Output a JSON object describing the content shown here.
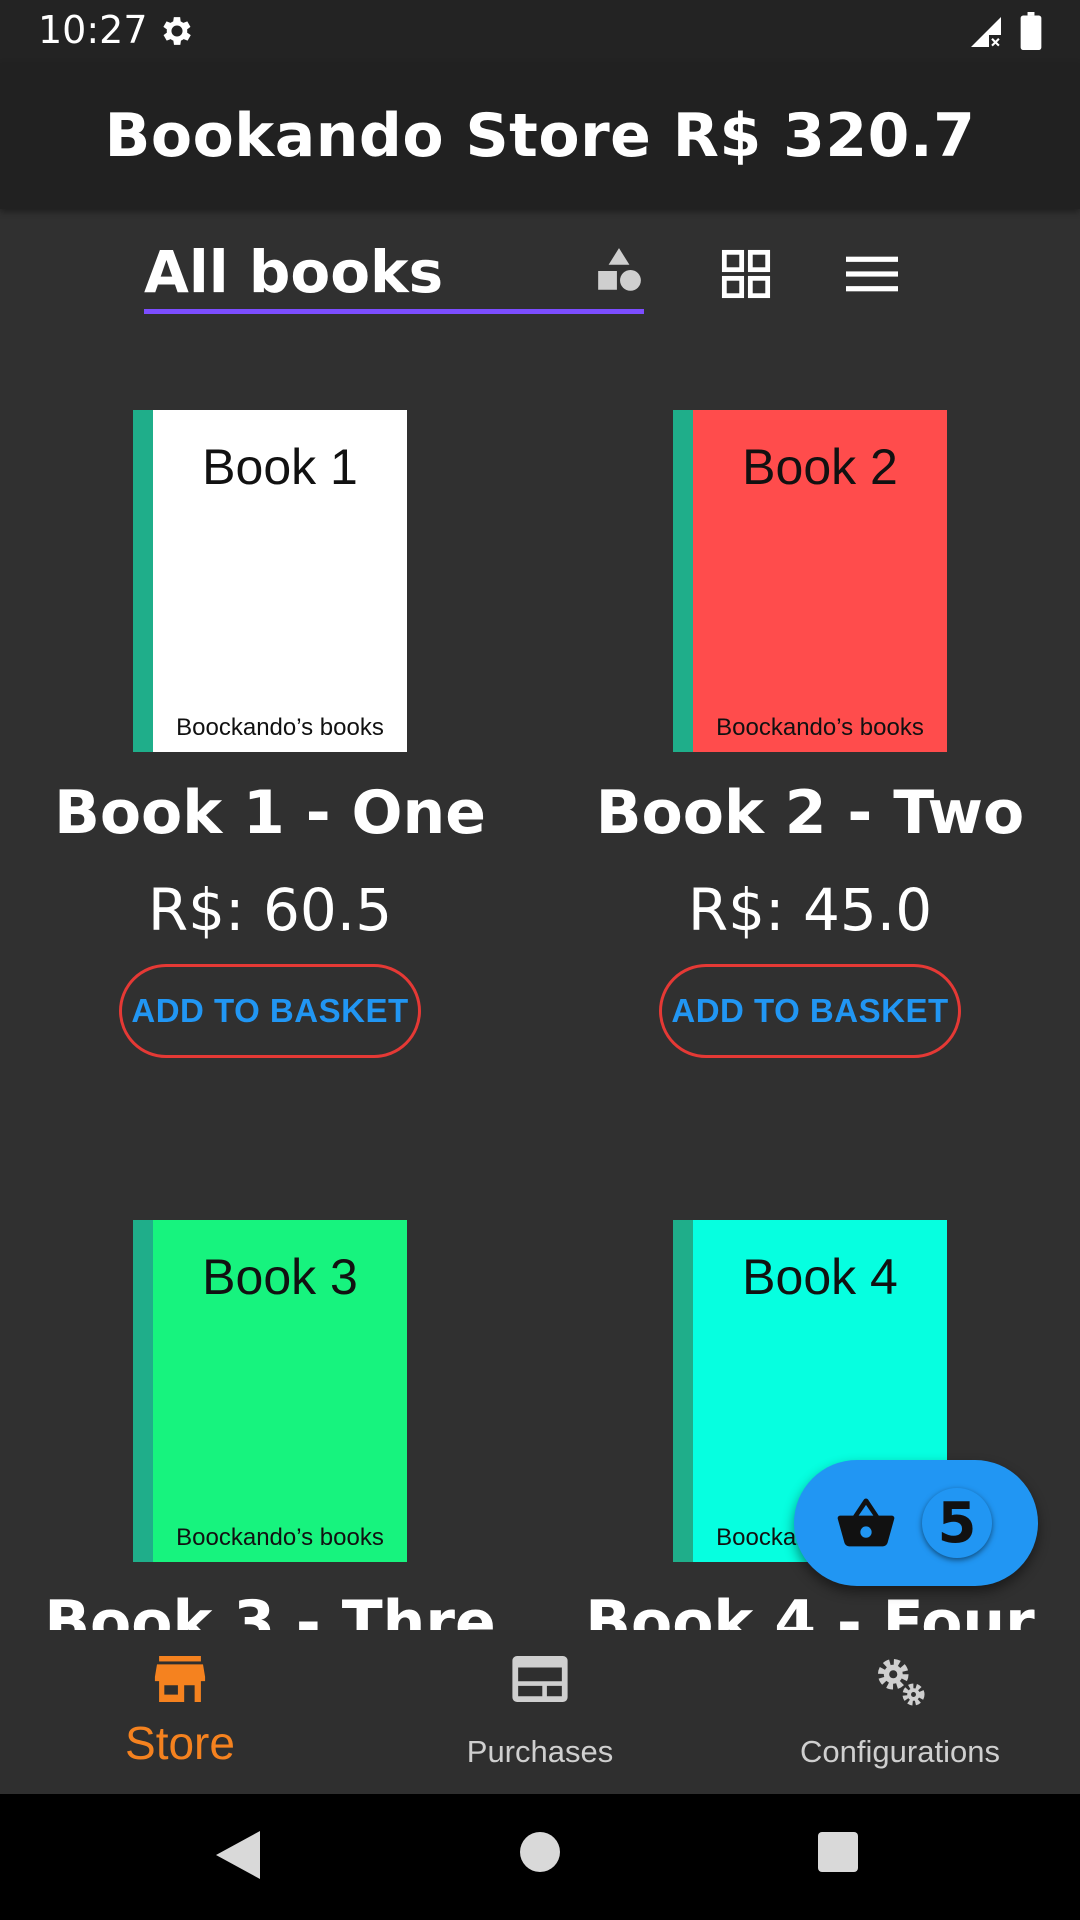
{
  "status_bar": {
    "time": "10:27",
    "icons": [
      "gear-icon",
      "signal-icon",
      "battery-icon"
    ]
  },
  "app_bar": {
    "title": "Bookando Store R$ 320.7"
  },
  "filter": {
    "selected": "All books",
    "icons": [
      "category-filter-icon",
      "grid-view-icon",
      "list-view-icon"
    ],
    "accent": "#7c4dff"
  },
  "books": [
    {
      "cover_title": "Book 1",
      "cover_publisher": "Boockando’s books",
      "cover_color": "#ffffff",
      "name": "Book 1 - One",
      "price": "R$: 60.5",
      "button_label": "ADD TO BASKET"
    },
    {
      "cover_title": "Book 2",
      "cover_publisher": "Boockando’s books",
      "cover_color": "#ff4c4c",
      "name": "Book 2 - Two",
      "price": "R$: 45.0",
      "button_label": "ADD TO BASKET"
    },
    {
      "cover_title": "Book 3",
      "cover_publisher": "Boockando’s books",
      "cover_color": "#17f37e",
      "name": "Book 3 - Thre",
      "price": "",
      "button_label": ""
    },
    {
      "cover_title": "Book 4",
      "cover_publisher": "Boockando’s books",
      "cover_color": "#06ffe0",
      "name": "Book 4 - Four",
      "price": "",
      "button_label": ""
    }
  ],
  "basket_fab": {
    "icon": "basket-icon",
    "count": "5",
    "color": "#2196f3"
  },
  "bottom_nav": {
    "items": [
      {
        "label": "Store",
        "icon": "store-icon",
        "active": true
      },
      {
        "label": "Purchases",
        "icon": "purchases-icon",
        "active": false
      },
      {
        "label": "Configurations",
        "icon": "settings-gears-icon",
        "active": false
      }
    ],
    "active_color": "#f5821f"
  },
  "colors": {
    "background": "#303030",
    "app_bar": "#212121",
    "button_border": "#e53935",
    "button_text": "#2196f3",
    "cover_spine": "#1fae8a"
  }
}
